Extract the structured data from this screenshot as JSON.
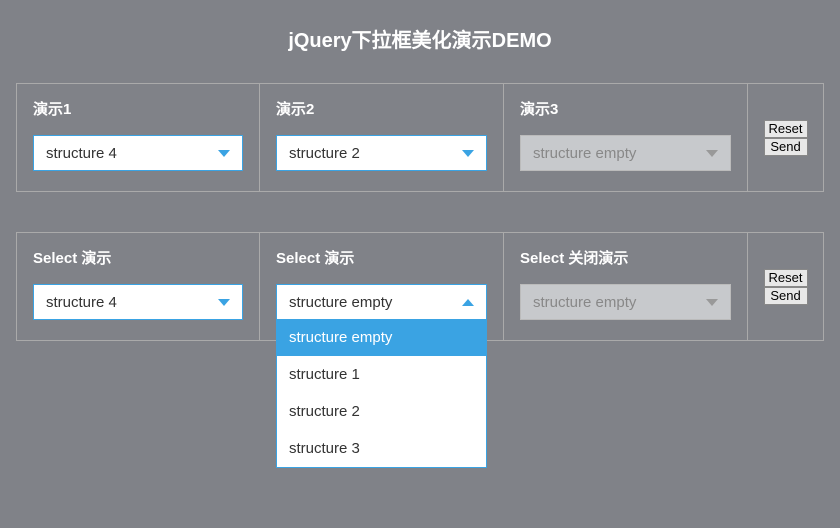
{
  "title": "jQuery下拉框美化演示DEMO",
  "row1": {
    "items": [
      {
        "label": "演示1",
        "value": "structure 4",
        "state": "closed",
        "disabled": false
      },
      {
        "label": "演示2",
        "value": "structure 2",
        "state": "closed",
        "disabled": false
      },
      {
        "label": "演示3",
        "value": "structure empty",
        "state": "closed",
        "disabled": true
      }
    ],
    "actions": {
      "reset": "Reset",
      "send": "Send"
    }
  },
  "row2": {
    "items": [
      {
        "label": "Select 演示",
        "value": "structure 4",
        "state": "closed",
        "disabled": false
      },
      {
        "label": "Select 演示",
        "value": "structure empty",
        "state": "open",
        "disabled": false,
        "options": [
          "structure empty",
          "structure 1",
          "structure 2",
          "structure 3"
        ],
        "selectedIndex": 0
      },
      {
        "label": "Select 关闭演示",
        "value": "structure empty",
        "state": "closed",
        "disabled": true
      }
    ],
    "actions": {
      "reset": "Reset",
      "send": "Send"
    }
  }
}
